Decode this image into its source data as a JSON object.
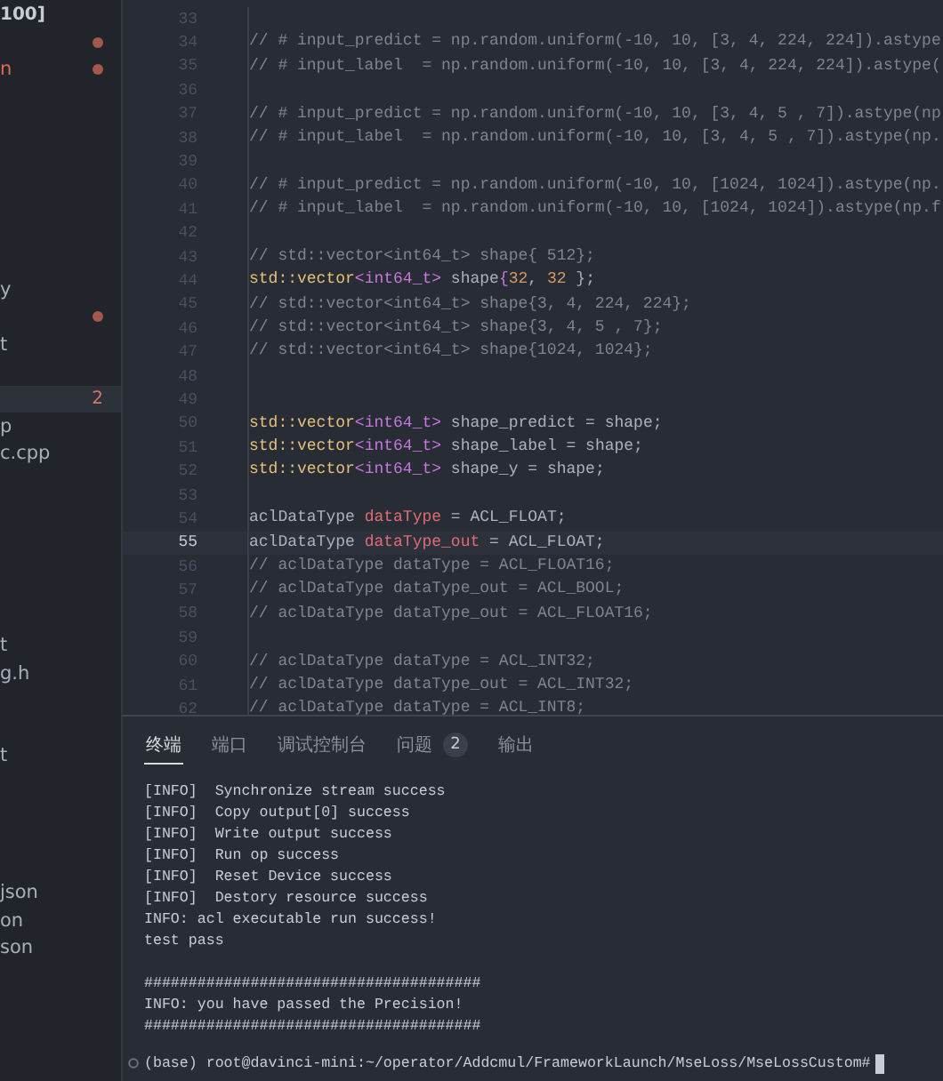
{
  "sidebar": {
    "header": "100]",
    "items": [
      {
        "kind": "blank",
        "dot": true
      },
      {
        "kind": "file",
        "text": "n",
        "modified": true,
        "dot": true
      },
      {
        "kind": "blank"
      },
      {
        "kind": "blank"
      },
      {
        "kind": "blank"
      },
      {
        "kind": "blank"
      },
      {
        "kind": "blank"
      },
      {
        "kind": "blank"
      },
      {
        "kind": "blank"
      },
      {
        "kind": "file",
        "text": "y",
        "modified": false
      },
      {
        "kind": "blank",
        "dot": true
      },
      {
        "kind": "file",
        "text": "t",
        "modified": false
      },
      {
        "kind": "blank"
      },
      {
        "kind": "file",
        "selected": true,
        "badge": "2"
      },
      {
        "kind": "file",
        "text": "p",
        "modified": false
      },
      {
        "kind": "file",
        "text": "c.cpp",
        "modified": false
      },
      {
        "kind": "blank"
      },
      {
        "kind": "blank"
      },
      {
        "kind": "blank"
      },
      {
        "kind": "blank"
      },
      {
        "kind": "blank"
      },
      {
        "kind": "blank"
      },
      {
        "kind": "file",
        "text": "t",
        "modified": false
      },
      {
        "kind": "file",
        "text": "g.h",
        "modified": false
      },
      {
        "kind": "blank"
      },
      {
        "kind": "blank"
      },
      {
        "kind": "file",
        "text": "t",
        "modified": false
      },
      {
        "kind": "blank"
      },
      {
        "kind": "blank"
      },
      {
        "kind": "blank"
      },
      {
        "kind": "blank"
      },
      {
        "kind": "file",
        "text": "json",
        "modified": false
      },
      {
        "kind": "file",
        "text": "on",
        "modified": false
      },
      {
        "kind": "file",
        "text": "son",
        "modified": false
      }
    ]
  },
  "editor": {
    "lines": [
      {
        "number": "33",
        "current": false
      },
      {
        "number": "34",
        "current": false,
        "tokens": [
          {
            "kind": "comment",
            "text": "// # input_predict = np.random.uniform(-10, 10, [3, 4, 224, 224]).astype"
          }
        ]
      },
      {
        "number": "35",
        "current": false,
        "tokens": [
          {
            "kind": "comment",
            "text": "// # input_label  = np.random.uniform(-10, 10, [3, 4, 224, 224]).astype("
          }
        ]
      },
      {
        "number": "36",
        "current": false
      },
      {
        "number": "37",
        "current": false,
        "tokens": [
          {
            "kind": "comment",
            "text": "// # input_predict = np.random.uniform(-10, 10, [3, 4, 5 , 7]).astype(np"
          }
        ]
      },
      {
        "number": "38",
        "current": false,
        "tokens": [
          {
            "kind": "comment",
            "text": "// # input_label  = np.random.uniform(-10, 10, [3, 4, 5 , 7]).astype(np."
          }
        ]
      },
      {
        "number": "39",
        "current": false
      },
      {
        "number": "40",
        "current": false,
        "tokens": [
          {
            "kind": "comment",
            "text": "// # input_predict = np.random.uniform(-10, 10, [1024, 1024]).astype(np."
          }
        ]
      },
      {
        "number": "41",
        "current": false,
        "tokens": [
          {
            "kind": "comment",
            "text": "// # input_label  = np.random.uniform(-10, 10, [1024, 1024]).astype(np.f"
          }
        ]
      },
      {
        "number": "42",
        "current": false
      },
      {
        "number": "43",
        "current": false,
        "tokens": [
          {
            "kind": "comment",
            "text": "// std::vector<int64_t> shape{ 512};"
          }
        ]
      },
      {
        "number": "44",
        "current": false,
        "tokens": [
          {
            "kind": "type",
            "text": "std::vector"
          },
          {
            "kind": "keyword",
            "text": "<int64_t>"
          },
          {
            "kind": "plain",
            "text": " shape"
          },
          {
            "kind": "keyword",
            "text": "{"
          },
          {
            "kind": "number",
            "text": "32"
          },
          {
            "kind": "plain",
            "text": ", "
          },
          {
            "kind": "number",
            "text": "32"
          },
          {
            "kind": "plain",
            "text": " };"
          }
        ]
      },
      {
        "number": "45",
        "current": false,
        "tokens": [
          {
            "kind": "comment",
            "text": "// std::vector<int64_t> shape{3, 4, 224, 224};"
          }
        ]
      },
      {
        "number": "46",
        "current": false,
        "tokens": [
          {
            "kind": "comment",
            "text": "// std::vector<int64_t> shape{3, 4, 5 , 7};"
          }
        ]
      },
      {
        "number": "47",
        "current": false,
        "tokens": [
          {
            "kind": "comment",
            "text": "// std::vector<int64_t> shape{1024, 1024};"
          }
        ]
      },
      {
        "number": "48",
        "current": false
      },
      {
        "number": "49",
        "current": false
      },
      {
        "number": "50",
        "current": false,
        "tokens": [
          {
            "kind": "type",
            "text": "std::vector"
          },
          {
            "kind": "keyword",
            "text": "<int64_t>"
          },
          {
            "kind": "plain",
            "text": " shape_predict = shape;"
          }
        ]
      },
      {
        "number": "51",
        "current": false,
        "tokens": [
          {
            "kind": "type",
            "text": "std::vector"
          },
          {
            "kind": "keyword",
            "text": "<int64_t>"
          },
          {
            "kind": "plain",
            "text": " shape_label = shape;"
          }
        ]
      },
      {
        "number": "52",
        "current": false,
        "tokens": [
          {
            "kind": "type",
            "text": "std::vector"
          },
          {
            "kind": "keyword",
            "text": "<int64_t>"
          },
          {
            "kind": "plain",
            "text": " shape_y = shape;"
          }
        ]
      },
      {
        "number": "53",
        "current": false
      },
      {
        "number": "54",
        "current": false,
        "tokens": [
          {
            "kind": "plain",
            "text": "aclDataType "
          },
          {
            "kind": "variable",
            "text": "dataType"
          },
          {
            "kind": "plain",
            "text": " = ACL_FLOAT;"
          }
        ]
      },
      {
        "number": "55",
        "current": true,
        "tokens": [
          {
            "kind": "plain",
            "text": "aclDataType "
          },
          {
            "kind": "variable",
            "text": "dataType_out"
          },
          {
            "kind": "plain",
            "text": " = ACL_FLOAT;"
          }
        ]
      },
      {
        "number": "56",
        "current": false,
        "tokens": [
          {
            "kind": "comment",
            "text": "// aclDataType dataType = ACL_FLOAT16;"
          }
        ]
      },
      {
        "number": "57",
        "current": false,
        "tokens": [
          {
            "kind": "comment",
            "text": "// aclDataType dataType_out = ACL_BOOL;"
          }
        ]
      },
      {
        "number": "58",
        "current": false,
        "tokens": [
          {
            "kind": "comment",
            "text": "// aclDataType dataType_out = ACL_FLOAT16;"
          }
        ]
      },
      {
        "number": "59",
        "current": false
      },
      {
        "number": "60",
        "current": false,
        "tokens": [
          {
            "kind": "comment",
            "text": "// aclDataType dataType = ACL_INT32;"
          }
        ]
      },
      {
        "number": "61",
        "current": false,
        "tokens": [
          {
            "kind": "comment",
            "text": "// aclDataType dataType_out = ACL_INT32;"
          }
        ]
      },
      {
        "number": "62",
        "current": false,
        "tokens": [
          {
            "kind": "comment",
            "text": "// aclDataType dataType = ACL_INT8;"
          }
        ]
      }
    ]
  },
  "panel": {
    "tabs": [
      {
        "label": "终端",
        "selected": true
      },
      {
        "label": "端口",
        "selected": false
      },
      {
        "label": "调试控制台",
        "selected": false
      },
      {
        "label": "问题",
        "selected": false,
        "badge": "2"
      },
      {
        "label": "输出",
        "selected": false
      }
    ],
    "output": [
      {
        "kind": "line",
        "text": "[INFO]  Synchronize stream success"
      },
      {
        "kind": "line",
        "text": "[INFO]  Copy output[0] success"
      },
      {
        "kind": "line",
        "text": "[INFO]  Write output success"
      },
      {
        "kind": "line",
        "text": "[INFO]  Run op success"
      },
      {
        "kind": "line",
        "text": "[INFO]  Reset Device success"
      },
      {
        "kind": "line",
        "text": "[INFO]  Destory resource success"
      },
      {
        "kind": "line",
        "text": "INFO: acl executable run success!"
      },
      {
        "kind": "line",
        "text": "test pass"
      },
      {
        "kind": "blank"
      },
      {
        "kind": "line",
        "text": "######################################"
      },
      {
        "kind": "line",
        "text": "INFO: you have passed the Precision!"
      },
      {
        "kind": "line",
        "text": "######################################"
      }
    ],
    "prompt": "(base) root@davinci-mini:~/operator/Addcmul/FrameworkLaunch/MseLoss/MseLossCustom#"
  }
}
